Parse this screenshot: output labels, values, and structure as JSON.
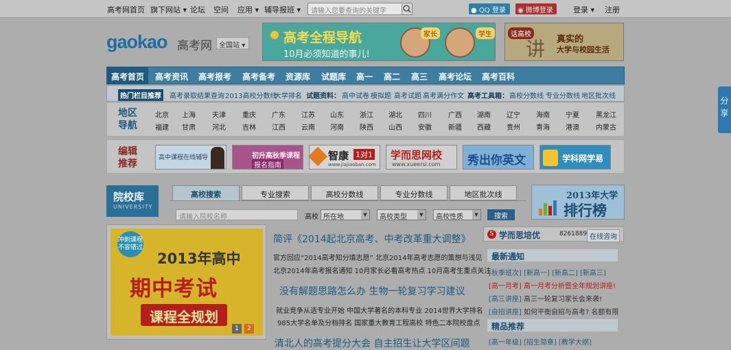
{
  "topbar": {
    "home": "高考网首页",
    "sites": "旗下网站",
    "forum": "论坛",
    "space": "空间",
    "apps": "应用",
    "tutoring": "辅导报班",
    "search_placeholder": "请输入您要查询的关键字",
    "qq_login": "QQ 登录",
    "weibo_login": "微博登录",
    "login": "登录",
    "register": "注册",
    "dropdown_glyph": "▾"
  },
  "header": {
    "logo": "gaokao",
    "logo_cn": "高考网",
    "region": "全国站",
    "banner1_title": "高考全程导航",
    "banner1_sub": "10月必须知道的事儿!",
    "banner1_tag1": "家长",
    "banner1_tag2": "学生",
    "banner2_tag": "话高校",
    "banner2_big": "讲",
    "banner2_t1": "真实的",
    "banner2_t2": "大学与校园生活"
  },
  "nav": {
    "tabs": [
      "高考首页",
      "高考资讯",
      "高考报考",
      "高考备考",
      "资源库",
      "试题库",
      "高一",
      "高二",
      "高三",
      "高考论坛",
      "高考百科"
    ]
  },
  "hotbar": {
    "label": "热门栏目推荐",
    "items": [
      "高考录取结果查询",
      "2013高校分数线",
      "大学排名"
    ],
    "exam_label": "试题资料：",
    "exam_items": [
      "高中试卷",
      "模拟题",
      "高考试题",
      "高考满分作文"
    ],
    "tools_label": "高考工具箱：",
    "tools_items": [
      "高校分数线",
      "专业分数线",
      "地区批次线"
    ]
  },
  "area": {
    "title": "地区导航",
    "row1": [
      "北京",
      "上海",
      "天津",
      "重庆",
      "广东",
      "江苏",
      "山东",
      "浙江",
      "湖北",
      "四川",
      "广西",
      "湖南",
      "辽宁",
      "海南",
      "宁夏",
      "黑龙江"
    ],
    "row2": [
      "福建",
      "甘肃",
      "河北",
      "吉林",
      "江西",
      "云南",
      "河南",
      "陕西",
      "山西",
      "安徽",
      "新疆",
      "西藏",
      "贵州",
      "青海",
      "港澳",
      "内蒙古"
    ]
  },
  "editor": {
    "title": "编辑推荐",
    "ad1": "高中课程在线辅导",
    "ad2a": "初升高秋季课程",
    "ad2b": "报名指南",
    "ad3a": "智康",
    "ad3b": "1对1",
    "ad3c": "www.jiajiaoban.com",
    "ad4a": "学而思网校",
    "ad4b": "www.xueersi.com",
    "ad5": "秀出你英文",
    "ad6": "学科网学易"
  },
  "school": {
    "logo": "院校库",
    "logo_en": "UNIVERSITY",
    "tabs": [
      "高校搜索",
      "专业搜索",
      "高校分数线",
      "专业分数线",
      "地区批次线"
    ],
    "input_placeholder": "请输入院校名称",
    "label_school": "高校",
    "sel_location": "所在地",
    "sel_type": "高校类型",
    "sel_nature": "高校性质",
    "search_btn": "搜索",
    "rank_t1": "2013年大学",
    "rank_t2": "排行榜",
    "arrow": "▼"
  },
  "promo": {
    "badge1": "冲刺课程",
    "badge2": "不容错过",
    "line1": "2013年高中",
    "line2": "期中考试",
    "line3": "课程全规划",
    "pages": [
      "1",
      "2"
    ]
  },
  "news": {
    "headline1": "简评《2014起北京高考、中考改革重大调整》",
    "l1": "官方回应“2014高考知分填志愿”   北京2014年高考志愿的策想与浅见",
    "l2": "北京2014年高考报名通知  10月家长必看高考热点  10月高考生重点关注",
    "headline2": "没有解题思路怎么办  生物一轮复习学习建议",
    "l3": "就业竞争从选专业开始  中国大学著名的本科专业  2014世界大学排名",
    "l4": "985大学名单及分档排名  国家重大教育工程高校  特色二本院校盘点",
    "headline3": "清北人的高考提分大会 自主招生让大学区间题"
  },
  "side": {
    "brand": "学而思培优",
    "brand_icon": "S",
    "phone": "82618899",
    "consult": "在线咨询",
    "latest": "最新通知",
    "items": [
      {
        "cat": "[秋季班次]",
        "text": "[新高一] [新高二] [新高三]"
      },
      {
        "cat": "[高一月考]",
        "text": "高一月考分析暨全年规划讲座!"
      },
      {
        "cat": "[高三讲座]",
        "text": "高三一轮复习家长会来袭!"
      },
      {
        "cat": "[自招讲座]",
        "text": "如何平衡自招与高考? 名额有限"
      }
    ],
    "featured": "精品推荐",
    "featured_line": "[高一年级]  [招生简章]  [教学大纲]"
  },
  "share": {
    "label": "分享"
  }
}
